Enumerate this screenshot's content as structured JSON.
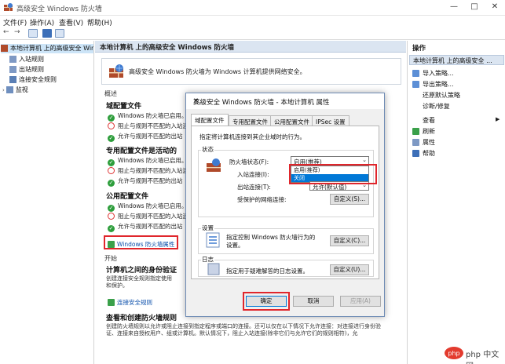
{
  "window": {
    "title": "高级安全 Windows 防火墙",
    "minimize": "—",
    "maximize": "□",
    "close": "✕"
  },
  "menu": [
    "文件(F)",
    "操作(A)",
    "查看(V)",
    "帮助(H)"
  ],
  "tree": {
    "root": "本地计算机 上的高级安全 Win",
    "items": [
      "入站规则",
      "出站规则",
      "连接安全规则",
      "监视"
    ]
  },
  "center": {
    "header": "本地计算机 上的高级安全 Windows 防火墙",
    "intro": "高级安全 Windows 防火墙为 Windows 计算机提供网络安全。",
    "overview_label": "概述",
    "profiles": [
      {
        "title": "域配置文件",
        "lines": [
          "Windows 防火墙已启用。",
          "阻止与规则不匹配的入站连",
          "允许与规则不匹配的出站"
        ]
      },
      {
        "title": "专用配置文件是活动的",
        "lines": [
          "Windows 防火墙已启用。",
          "阻止与规则不匹配的入站连",
          "允许与规则不匹配的出站"
        ]
      },
      {
        "title": "公用配置文件",
        "lines": [
          "Windows 防火墙已启用。",
          "阻止与规则不匹配的入站连",
          "允许与规则不匹配的出站"
        ]
      }
    ],
    "properties_link": "Windows 防火墙属性",
    "start_label": "开始",
    "auth_title": "计算机之间的身份验证",
    "auth_text_1": "创建连接安全规则指定使用",
    "auth_text_2": "和保护。",
    "conn_link": "连接安全规则",
    "rules_title": "查看和创建防火墙规则",
    "rules_text_1": "创建防火墙规则以允许或阻止连接到指定程序或端口的连接。还可以仅在以下情况下允许连接：对连接进行身份验",
    "rules_text_2": "证、连接来自授权用户、组或计算机。默认情况下，阻止入站连接(除非它们与允许它们的规则相符)，允"
  },
  "actions": {
    "header": "操作",
    "sub": "本地计算机 上的高级安全 ...",
    "items": [
      "导入策略...",
      "导出策略...",
      "还原默认策略",
      "诊断/修复",
      "查看",
      "刷新",
      "属性",
      "帮助"
    ]
  },
  "dialog": {
    "title": "高级安全 Windows 防火墙 - 本地计算机 属性",
    "close": "✕",
    "tabs": [
      "域配置文件",
      "专用配置文件",
      "公用配置文件",
      "IPSec 设置"
    ],
    "description": "指定将计算机连接到其企业域时的行为。",
    "state_group": "状态",
    "firewall_state_label": "防火墙状态(F):",
    "firewall_state_value": "启用(推荐)",
    "dropdown_options": [
      "启用(推荐)",
      "关闭"
    ],
    "inbound_label": "入站连接(I):",
    "outbound_label": "出站连接(T):",
    "outbound_value": "允许(默认值)",
    "protected_label": "受保护的网络连接:",
    "customize_1": "自定义(S)...",
    "settings_group": "设置",
    "settings_text_1": "指定控制 Windows 防火墙行为的",
    "settings_text_2": "设置。",
    "customize_2": "自定义(C)...",
    "log_group": "日志",
    "log_text": "指定用于疑难解答的日志设置。",
    "customize_3": "自定义(U)...",
    "ok": "确定",
    "cancel": "取消",
    "apply": "应用(A)"
  },
  "watermark": "php 中文网",
  "colors": {
    "accent_red": "#e0262c",
    "link_blue": "#0a4eaa",
    "header_blue": "#dbe5f1",
    "ok_green": "#2e9e3c",
    "select_blue": "#0078d7"
  }
}
